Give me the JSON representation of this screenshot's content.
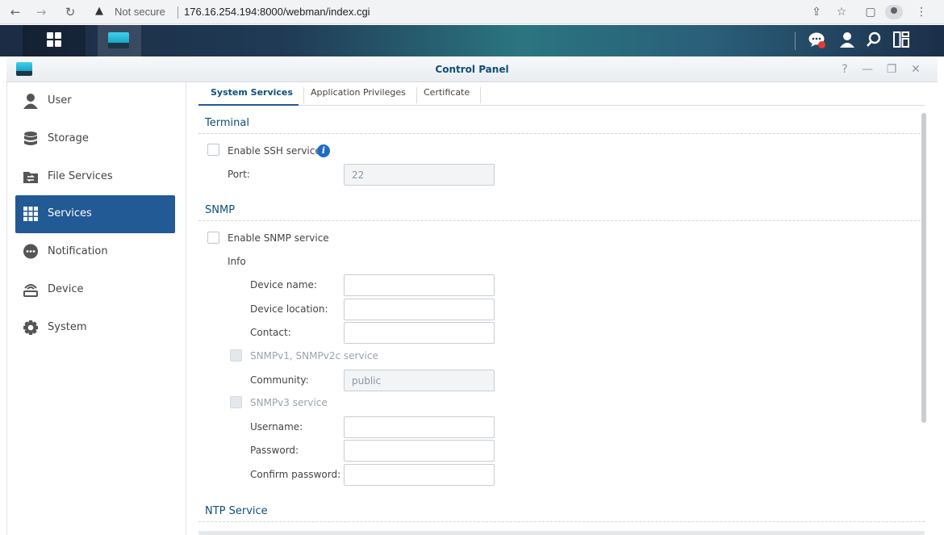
{
  "browser": {
    "security_label": "Not secure",
    "url": "176.16.254.194:8000/webman/index.cgi"
  },
  "window": {
    "title": "Control Panel"
  },
  "sidebar": {
    "items": [
      {
        "label": "User",
        "icon": "user-icon"
      },
      {
        "label": "Storage",
        "icon": "storage-icon"
      },
      {
        "label": "File Services",
        "icon": "file-services-icon"
      },
      {
        "label": "Services",
        "icon": "services-icon",
        "active": true
      },
      {
        "label": "Notification",
        "icon": "notification-icon"
      },
      {
        "label": "Device",
        "icon": "device-icon"
      },
      {
        "label": "System",
        "icon": "system-icon"
      }
    ]
  },
  "tabs": [
    {
      "label": "System Services",
      "active": true
    },
    {
      "label": "Application Privileges"
    },
    {
      "label": "Certificate"
    }
  ],
  "terminal": {
    "title": "Terminal",
    "enable_ssh_label": "Enable SSH service",
    "enable_ssh_checked": false,
    "port_label": "Port:",
    "port_value": "22"
  },
  "snmp": {
    "title": "SNMP",
    "enable_label": "Enable SNMP service",
    "enable_checked": false,
    "info_label": "Info",
    "device_name_label": "Device name:",
    "device_name_value": "",
    "device_location_label": "Device location:",
    "device_location_value": "",
    "contact_label": "Contact:",
    "contact_value": "",
    "v1v2c_label": "SNMPv1, SNMPv2c service",
    "community_label": "Community:",
    "community_value": "public",
    "v3_label": "SNMPv3 service",
    "username_label": "Username:",
    "username_value": "",
    "password_label": "Password:",
    "password_value": "",
    "confirm_password_label": "Confirm password:",
    "confirm_password_value": ""
  },
  "ntp": {
    "title": "NTP Service"
  },
  "colors": {
    "accent": "#215a94",
    "section_title": "#0e4f7a",
    "notification_badge": "#e83a2e"
  }
}
